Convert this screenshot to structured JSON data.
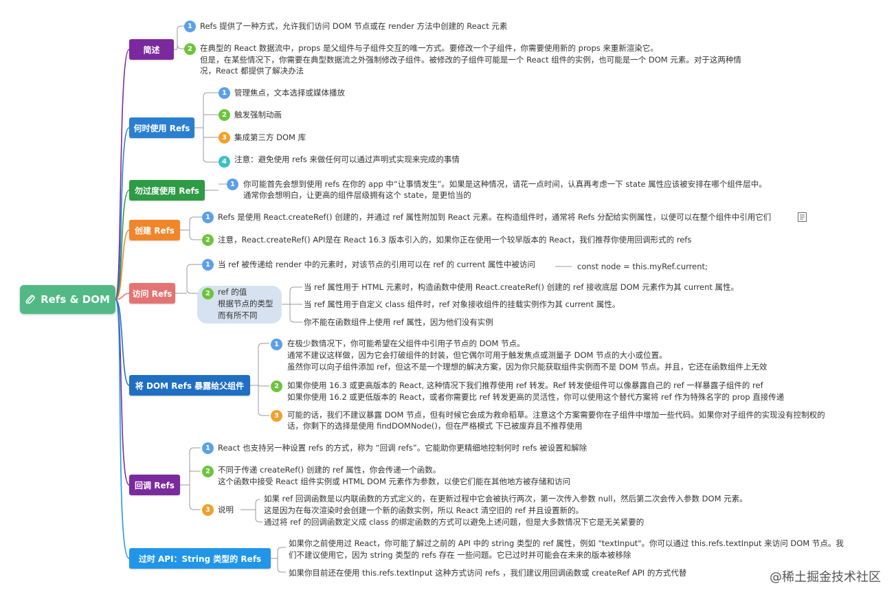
{
  "root": {
    "label": "Refs & DOM",
    "icon": "paperclip-icon"
  },
  "topics": {
    "overview": "简述",
    "when_use": "何时使用 Refs",
    "no_overuse": "勿过度使用 Refs",
    "create": "创建 Refs",
    "access": "访问 Refs",
    "expose": "将 DOM Refs 暴露给父组件",
    "callback": "回调 Refs",
    "legacy": "过时 API：String 类型的 Refs"
  },
  "colors": {
    "overview": "#7b2a9e",
    "when_use": "#2a7fd0",
    "no_overuse": "#2e9b45",
    "create": "#f0862a",
    "access": "#e57373",
    "expose": "#1f6fc2",
    "callback": "#7b2a9e",
    "legacy": "#2196e8"
  },
  "badges": {
    "n1": "1",
    "n2": "2",
    "n3": "3",
    "n4": "4"
  },
  "overview": {
    "item1": "Refs 提供了一种方式，允许我们访问 DOM 节点或在 render 方法中创建的 React 元素",
    "item2_l1": "在典型的 React 数据流中，props 是父组件与子组件交互的唯一方式。要修改一个子组件，你需要使用新的 props 来重新渲染它。",
    "item2_l2": "但是，在某些情况下，你需要在典型数据流之外强制修改子组件。被修改的子组件可能是一个 React 组件的实例，也可能是一个 DOM 元素。对于这两种情",
    "item2_l3": "况，React 都提供了解决办法"
  },
  "when_use": {
    "item1": "管理焦点，文本选择或媒体播放",
    "item2": "触发强制动画",
    "item3": "集成第三方 DOM 库",
    "item4": "注意：避免使用 refs 来做任何可以通过声明式实现来完成的事情"
  },
  "no_overuse": {
    "l1": "你可能首先会想到使用 refs 在你的 app 中“让事情发生”。如果是这种情况，请花一点时间，认真再考虑一下 state 属性应该被安排在哪个组件层中。",
    "l2": "通常你会想明白，让更高的组件层级拥有这个 state，是更恰当的"
  },
  "create": {
    "item1": "Refs 是使用 React.createRef() 创建的，并通过 ref 属性附加到 React 元素。在构造组件时，通常将 Refs 分配给实例属性，以便可以在整个组件中引用它们",
    "note_icon": "note-icon",
    "item2": "注意，React.createRef() API是在 React 16.3 版本引入的，如果你正在使用一个较早版本的 React，我们推荐你使用回调形式的 refs"
  },
  "access": {
    "item1": "当 ref 被传递给 render 中的元素时，对该节点的引用可以在 ref 的 current 属性中被访问",
    "code": "const node = this.myRef.current;",
    "item2_l1": "ref 的值",
    "item2_l2": "根据节点的类型",
    "item2_l3": "而有所不同",
    "sub1": "当 ref 属性用于 HTML 元素时，构造函数中使用 React.createRef() 创建的 ref 接收底层 DOM 元素作为其 current 属性。",
    "sub2": "当 ref 属性用于自定义 class 组件时，ref 对象接收组件的挂载实例作为其 current 属性。",
    "sub3": "你不能在函数组件上使用 ref 属性，因为他们没有实例"
  },
  "expose": {
    "item1_l1": "在极少数情况下，你可能希望在父组件中引用子节点的 DOM 节点。",
    "item1_l2": "通常不建议这样做，因为它会打破组件的封装，但它偶尔可用于触发焦点或测量子 DOM 节点的大小或位置。",
    "item1_l3": "虽然你可以向子组件添加 ref，但这不是一个理想的解决方案，因为你只能获取组件实例而不是 DOM 节点。并且，它还在函数组件上无效",
    "item2_l1": "如果你使用 16.3 或更高版本的 React, 这种情况下我们推荐使用 ref 转发。Ref 转发使组件可以像暴露自己的 ref 一样暴露子组件的 ref",
    "item2_l2": "如果你使用 16.2 或更低版本的 React，或者你需要比 ref 转发更高的灵活性，你可以使用这个替代方案将 ref 作为特殊名字的 prop 直接传递",
    "item3_l1": "可能的话，我们不建议暴露 DOM 节点，但有时候它会成为救命稻草。注意这个方案需要你在子组件中增加一些代码。如果你对子组件的实现没有控制权的",
    "item3_l2": "话，你剩下的选择是使用 findDOMNode()，但在严格模式 下已被废弃且不推荐使用"
  },
  "callback": {
    "item1": "React 也支持另一种设置 refs 的方式，称为 “回调 refs”。它能助你更精细地控制何时 refs 被设置和解除",
    "item2_l1": "不同于传递 createRef() 创建的 ref 属性，你会传递一个函数。",
    "item2_l2": "这个函数中接受 React 组件实例或 HTML DOM 元素作为参数，以使它们能在其他地方被存储和访问",
    "item3": "说明",
    "note_l1": "如果 ref 回调函数是以内联函数的方式定义的，在更新过程中它会被执行两次，第一次传入参数 null，然后第二次会传入参数 DOM 元素。",
    "note_l2": "这是因为在每次渲染时会创建一个新的函数实例，所以 React 清空旧的 ref 并且设置新的。",
    "note_l3": "通过将 ref 的回调函数定义成 class 的绑定函数的方式可以避免上述问题，但是大多数情况下它是无关紧要的"
  },
  "legacy": {
    "item1_l1": "如果你之前使用过 React，你可能了解过之前的 API 中的 string 类型的 ref 属性，例如 \"textInput\"。你可以通过 this.refs.textInput 来访问 DOM 节点。我",
    "item1_l2": "们不建议使用它，因为 string 类型的 refs 存在 一些问题。它已过时并可能会在未来的版本被移除",
    "item2": "如果你目前还在使用 this.refs.textInput 这种方式访问 refs ，我们建议用回调函数或 createRef API 的方式代替"
  },
  "watermark": "@稀土掘金技术社区"
}
